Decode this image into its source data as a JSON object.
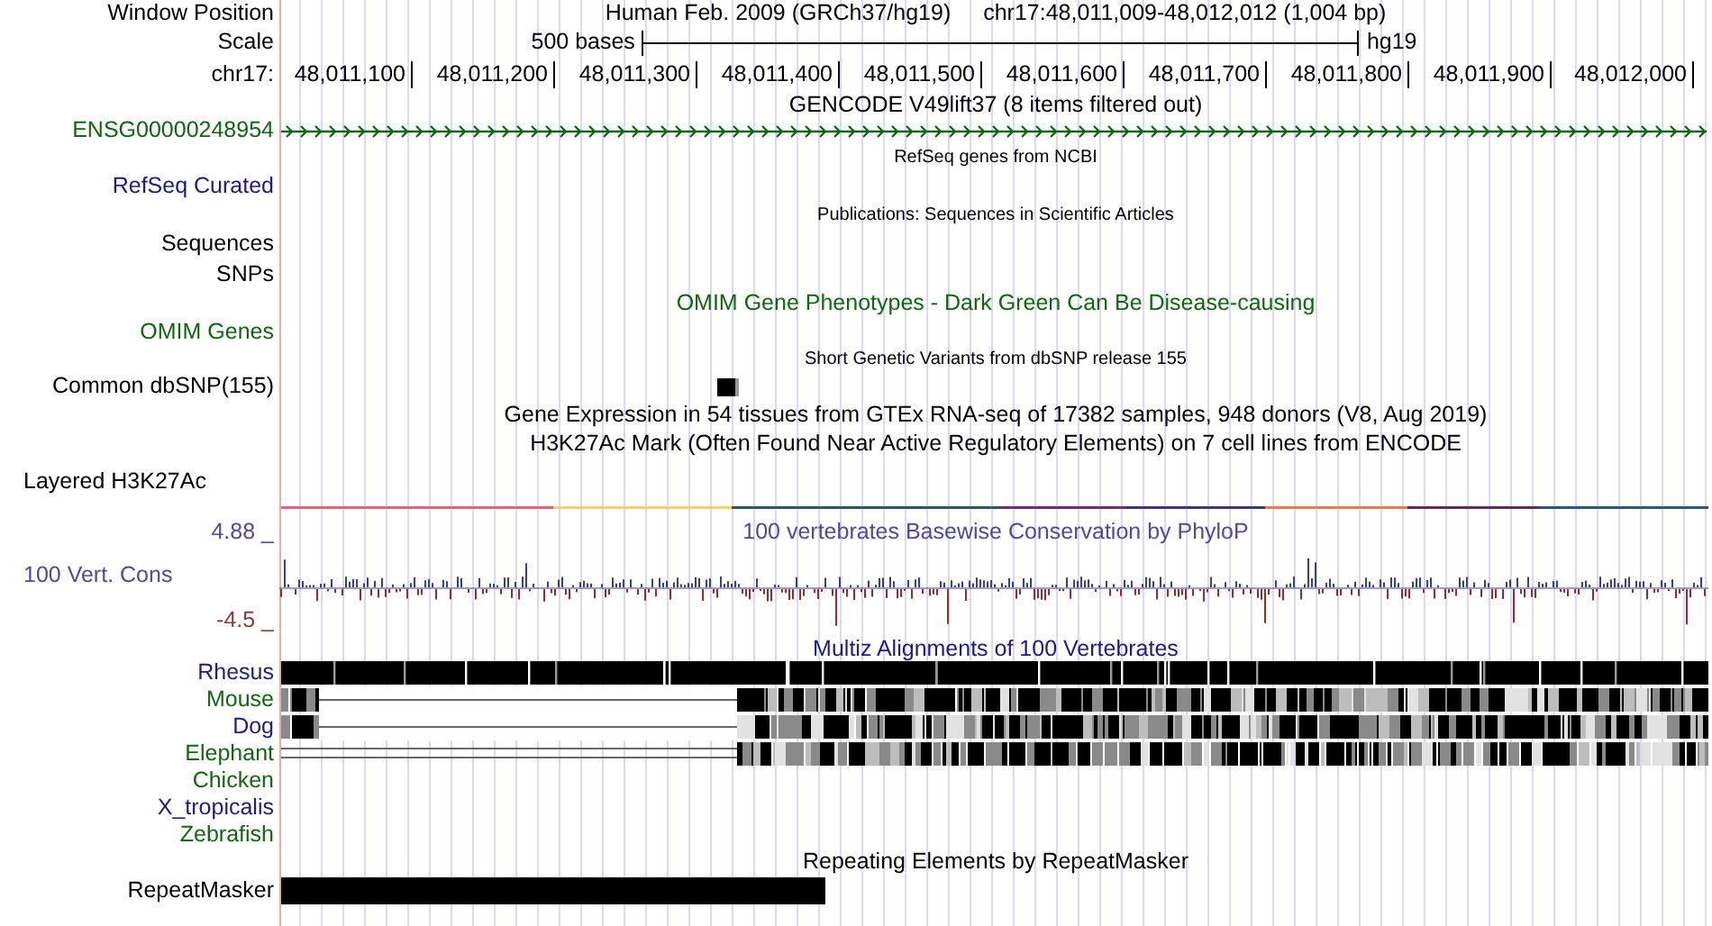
{
  "header": {
    "label": "Window Position",
    "assembly": "Human Feb. 2009 (GRCh37/hg19)",
    "position": "chr17:48,011,009-48,012,012 (1,004 bp)"
  },
  "scale": {
    "label": "Scale",
    "length": "500 bases",
    "database": "hg19"
  },
  "ruler": {
    "label": "chr17:",
    "ticks": [
      "48,011,100",
      "48,011,200",
      "48,011,300",
      "48,011,400",
      "48,011,500",
      "48,011,600",
      "48,011,700",
      "48,011,800",
      "48,011,900",
      "48,012,000"
    ]
  },
  "tracks": [
    {
      "kind": "gene",
      "title": "GENCODE V49lift37 (8 items filtered out)",
      "labels": [
        "ENSG00000248954"
      ],
      "color": "#116611"
    },
    {
      "kind": "empty",
      "title": "RefSeq genes from NCBI",
      "labels": [
        "RefSeq Curated"
      ],
      "color": "#1c1c80"
    },
    {
      "kind": "empty",
      "title": "Publications: Sequences in Scientific Articles",
      "labels": [
        "Sequences",
        "SNPs"
      ],
      "color": "#000000"
    },
    {
      "kind": "omim",
      "title": "OMIM Gene Phenotypes - Dark Green Can Be Disease-causing",
      "labels": [
        "OMIM Genes"
      ],
      "color": "#116611"
    },
    {
      "kind": "variants",
      "title": "Short Genetic Variants from dbSNP release 155",
      "labels": [
        "Common dbSNP(155)"
      ],
      "color": "#000000"
    },
    {
      "kind": "heading",
      "title": "Gene Expression in 54 tissues from GTEx RNA-seq of 17382 samples, 948 donors (V8, Aug 2019)"
    },
    {
      "kind": "layered",
      "title": "H3K27Ac Mark (Often Found Near Active Regulatory Elements) on 7 cell lines from ENCODE",
      "labels": [
        "Layered H3K27Ac"
      ],
      "color": "#000000"
    },
    {
      "kind": "conservation",
      "title": "100 vertebrates Basewise Conservation by PhyloP",
      "labels": [
        "100 Vert. Cons"
      ],
      "color": "#4b4b9b",
      "max": "4.88 _",
      "min": "-4.5 _"
    },
    {
      "kind": "multiz",
      "title": "Multiz Alignments of 100 Vertebrates",
      "species": [
        {
          "name": "Rhesus",
          "color": "#1c1c80",
          "kind": "full"
        },
        {
          "name": "Mouse",
          "color": "#116611",
          "kind": "gapped"
        },
        {
          "name": "Dog",
          "color": "#1c1c80",
          "kind": "gapped"
        },
        {
          "name": "Elephant",
          "color": "#116611",
          "kind": "double"
        },
        {
          "name": "Chicken",
          "color": "#116611",
          "kind": "none"
        },
        {
          "name": "X_tropicalis",
          "color": "#1c1c80",
          "kind": "none"
        },
        {
          "name": "Zebrafish",
          "color": "#116611",
          "kind": "none"
        }
      ]
    },
    {
      "kind": "repeats",
      "title": "Repeating Elements by RepeatMasker",
      "labels": [
        "RepeatMasker"
      ],
      "color": "#000000"
    }
  ]
}
